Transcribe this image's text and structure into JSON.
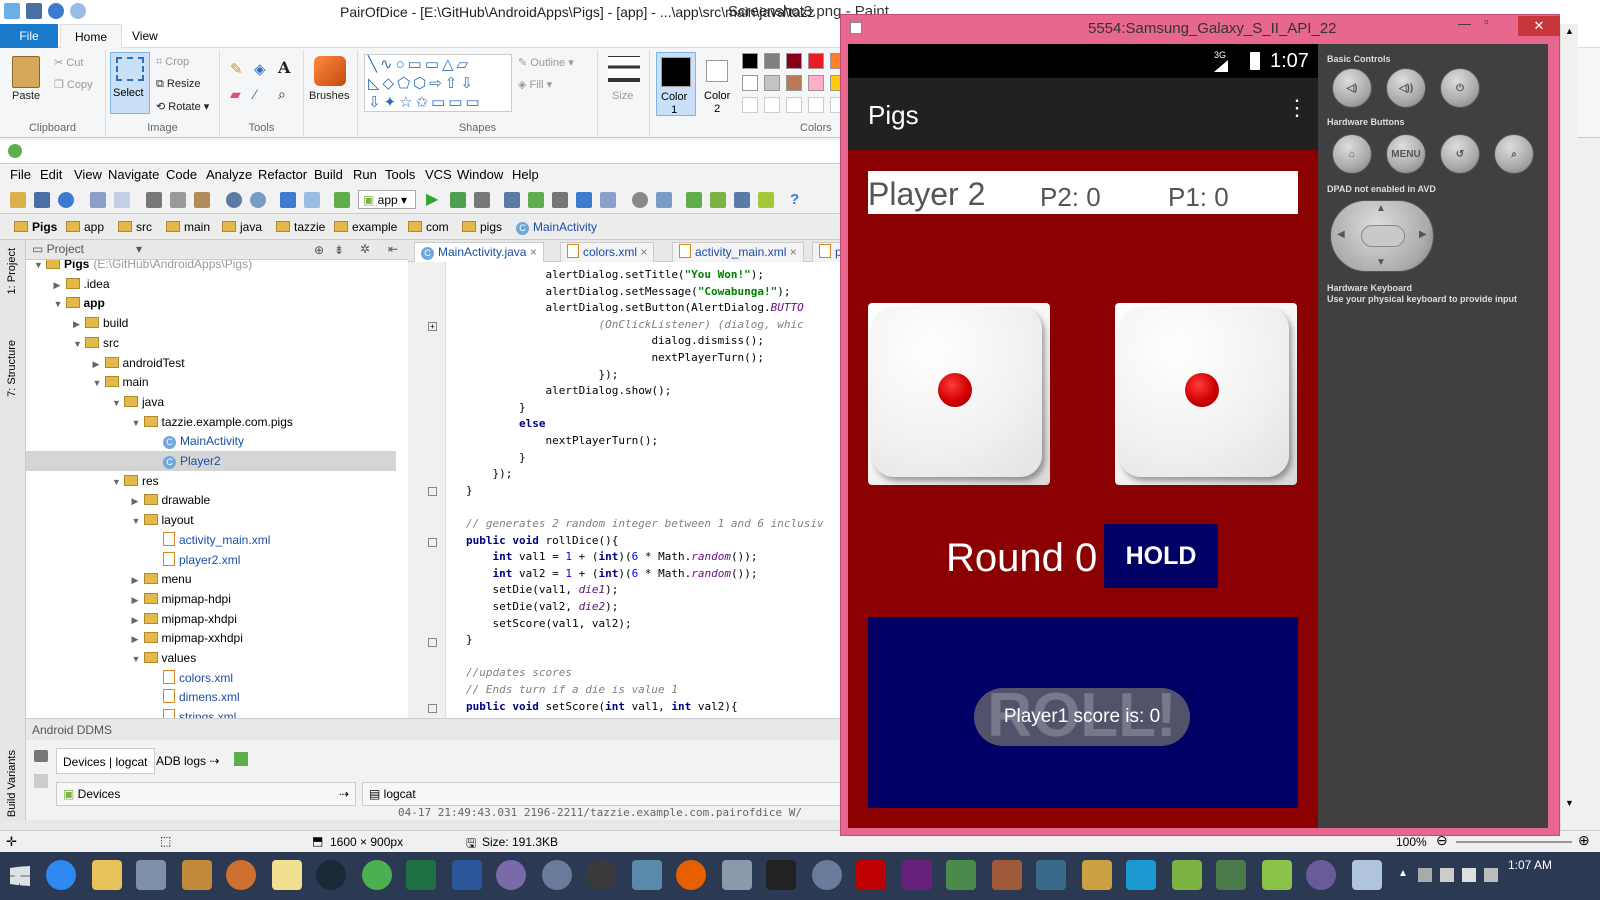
{
  "paint": {
    "title": "Screenshot3.png - Paint",
    "tabs": {
      "file": "File",
      "home": "Home",
      "view": "View"
    },
    "clipboard": {
      "paste": "Paste",
      "cut": "Cut",
      "copy": "Copy",
      "label": "Clipboard"
    },
    "image": {
      "select": "Select",
      "crop": "Crop",
      "resize": "Resize",
      "rotate": "Rotate",
      "label": "Image"
    },
    "tools_label": "Tools",
    "brushes": "Brushes",
    "shapes": {
      "outline": "Outline",
      "fill": "Fill",
      "label": "Shapes"
    },
    "size": "Size",
    "color1": "Color\n1",
    "color2": "Color\n2",
    "colors_label": "Colors",
    "palette": [
      "#000000",
      "#7f7f7f",
      "#880015",
      "#ed1c24",
      "#ff7f27",
      "#ffffff",
      "#c3c3c3",
      "#b97a57",
      "#ffaec9",
      "#ffc90e"
    ],
    "status": {
      "dimensions": "1600 × 900px",
      "size": "Size: 191.3KB",
      "zoom": "100%"
    }
  },
  "ide": {
    "title": "PairOfDice - [E:\\GitHub\\AndroidApps\\Pigs] - [app] - ...\\app\\src\\main\\java\\tazz",
    "menu": [
      "File",
      "Edit",
      "View",
      "Navigate",
      "Code",
      "Analyze",
      "Refactor",
      "Build",
      "Run",
      "Tools",
      "VCS",
      "Window",
      "Help"
    ],
    "run_config": "app",
    "breadcrumb": [
      "Pigs",
      "app",
      "src",
      "main",
      "java",
      "tazzie",
      "example",
      "com",
      "pigs",
      "MainActivity"
    ],
    "side_tabs": {
      "project": "1: Project",
      "structure": "7: Structure",
      "variants": "Build Variants"
    },
    "project_panel": "Project",
    "tree": [
      {
        "label": "Pigs",
        "extra": "(E:\\GitHub\\AndroidApps\\Pigs)",
        "depth": 0,
        "arrow": "▼",
        "kind": "folder"
      },
      {
        "label": ".idea",
        "depth": 1,
        "arrow": "▶",
        "kind": "folder"
      },
      {
        "label": "app",
        "depth": 1,
        "arrow": "▼",
        "kind": "folder"
      },
      {
        "label": "build",
        "depth": 2,
        "arrow": "▶",
        "kind": "folder"
      },
      {
        "label": "src",
        "depth": 2,
        "arrow": "▼",
        "kind": "folder"
      },
      {
        "label": "androidTest",
        "depth": 3,
        "arrow": "▶",
        "kind": "folder"
      },
      {
        "label": "main",
        "depth": 3,
        "arrow": "▼",
        "kind": "folder"
      },
      {
        "label": "java",
        "depth": 4,
        "arrow": "▼",
        "kind": "folder"
      },
      {
        "label": "tazzie.example.com.pigs",
        "depth": 5,
        "arrow": "▼",
        "kind": "folder"
      },
      {
        "label": "MainActivity",
        "depth": 6,
        "arrow": "",
        "kind": "class"
      },
      {
        "label": "Player2",
        "depth": 6,
        "arrow": "",
        "kind": "class",
        "selected": true
      },
      {
        "label": "res",
        "depth": 4,
        "arrow": "▼",
        "kind": "folder"
      },
      {
        "label": "drawable",
        "depth": 5,
        "arrow": "▶",
        "kind": "folder"
      },
      {
        "label": "layout",
        "depth": 5,
        "arrow": "▼",
        "kind": "folder"
      },
      {
        "label": "activity_main.xml",
        "depth": 6,
        "arrow": "",
        "kind": "xml"
      },
      {
        "label": "player2.xml",
        "depth": 6,
        "arrow": "",
        "kind": "xml"
      },
      {
        "label": "menu",
        "depth": 5,
        "arrow": "▶",
        "kind": "folder"
      },
      {
        "label": "mipmap-hdpi",
        "depth": 5,
        "arrow": "▶",
        "kind": "folder"
      },
      {
        "label": "mipmap-xhdpi",
        "depth": 5,
        "arrow": "▶",
        "kind": "folder"
      },
      {
        "label": "mipmap-xxhdpi",
        "depth": 5,
        "arrow": "▶",
        "kind": "folder"
      },
      {
        "label": "values",
        "depth": 5,
        "arrow": "▼",
        "kind": "folder"
      },
      {
        "label": "colors.xml",
        "depth": 6,
        "arrow": "",
        "kind": "xml"
      },
      {
        "label": "dimens.xml",
        "depth": 6,
        "arrow": "",
        "kind": "xml"
      },
      {
        "label": "strings.xml",
        "depth": 6,
        "arrow": "",
        "kind": "xml"
      }
    ],
    "editor_tabs": [
      "MainActivity.java",
      "colors.xml",
      "activity_main.xml",
      "play"
    ],
    "code": [
      {
        "i": "            ",
        "t": [
          [
            "",
            "alertDialog.setTitle("
          ],
          [
            "str",
            "\"You Won!\""
          ],
          [
            "",
            ");"
          ]
        ]
      },
      {
        "i": "            ",
        "t": [
          [
            "",
            "alertDialog.setMessage("
          ],
          [
            "str",
            "\"Cowabunga!\""
          ],
          [
            "",
            ");"
          ]
        ]
      },
      {
        "i": "            ",
        "t": [
          [
            "",
            "alertDialog.setButton(AlertDialog."
          ],
          [
            "fld",
            "BUTTO"
          ]
        ]
      },
      {
        "i": "                    ",
        "t": [
          [
            "cm",
            "(OnClickListener) (dialog, whic"
          ]
        ]
      },
      {
        "i": "                            ",
        "t": [
          [
            "",
            "dialog.dismiss();"
          ]
        ]
      },
      {
        "i": "                            ",
        "t": [
          [
            "",
            "nextPlayerTurn();"
          ]
        ]
      },
      {
        "i": "                    ",
        "t": [
          [
            "",
            "});"
          ]
        ]
      },
      {
        "i": "            ",
        "t": [
          [
            "",
            "alertDialog.show();"
          ]
        ]
      },
      {
        "i": "        ",
        "t": [
          [
            "",
            "}"
          ]
        ]
      },
      {
        "i": "        ",
        "t": [
          [
            "kw",
            "else"
          ]
        ]
      },
      {
        "i": "            ",
        "t": [
          [
            "",
            "nextPlayerTurn();"
          ]
        ]
      },
      {
        "i": "        ",
        "t": [
          [
            "",
            "}"
          ]
        ]
      },
      {
        "i": "    ",
        "t": [
          [
            "",
            "});"
          ]
        ]
      },
      {
        "i": "",
        "t": [
          [
            "",
            "}"
          ]
        ]
      },
      {
        "i": "",
        "t": [
          [
            "",
            ""
          ]
        ]
      },
      {
        "i": "",
        "t": [
          [
            "cm",
            "// generates 2 random integer between 1 and 6 inclusiv"
          ]
        ]
      },
      {
        "i": "",
        "t": [
          [
            "kw",
            "public void "
          ],
          [
            "",
            "rollDice(){"
          ]
        ]
      },
      {
        "i": "    ",
        "t": [
          [
            "kw",
            "int "
          ],
          [
            "",
            "val1 = "
          ],
          [
            "num",
            "1"
          ],
          [
            "",
            " + ("
          ],
          [
            "kw",
            "int"
          ],
          [
            "",
            ")("
          ],
          [
            "num",
            "6"
          ],
          [
            "",
            " * Math."
          ],
          [
            "fld",
            "random"
          ],
          [
            "",
            "());"
          ]
        ]
      },
      {
        "i": "    ",
        "t": [
          [
            "kw",
            "int "
          ],
          [
            "",
            "val2 = "
          ],
          [
            "num",
            "1"
          ],
          [
            "",
            " + ("
          ],
          [
            "kw",
            "int"
          ],
          [
            "",
            ")("
          ],
          [
            "num",
            "6"
          ],
          [
            "",
            " * Math."
          ],
          [
            "fld",
            "random"
          ],
          [
            "",
            "());"
          ]
        ]
      },
      {
        "i": "    ",
        "t": [
          [
            "",
            "setDie(val1, "
          ],
          [
            "fld",
            "die1"
          ],
          [
            "",
            ");"
          ]
        ]
      },
      {
        "i": "    ",
        "t": [
          [
            "",
            "setDie(val2, "
          ],
          [
            "fld",
            "die2"
          ],
          [
            "",
            ");"
          ]
        ]
      },
      {
        "i": "    ",
        "t": [
          [
            "",
            "setScore(val1, val2);"
          ]
        ]
      },
      {
        "i": "",
        "t": [
          [
            "",
            "}"
          ]
        ]
      },
      {
        "i": "",
        "t": [
          [
            "",
            ""
          ]
        ]
      },
      {
        "i": "",
        "t": [
          [
            "cm",
            "//updates scores"
          ]
        ]
      },
      {
        "i": "",
        "t": [
          [
            "cm",
            "// Ends turn if a die is value 1"
          ]
        ]
      },
      {
        "i": "",
        "t": [
          [
            "kw",
            "public void "
          ],
          [
            "",
            "setScore("
          ],
          [
            "kw",
            "int "
          ],
          [
            "",
            "val1, "
          ],
          [
            "kw",
            "int "
          ],
          [
            "",
            "val2){"
          ]
        ]
      }
    ],
    "ddms": {
      "title": "Android DDMS",
      "devices_tab": "Devices | logcat",
      "adb_tab": "ADB logs",
      "devices": "Devices",
      "logcat": "logcat",
      "log_line": "04-17 21:49:43.031    2196-2211/tazzie.example.com.pairofdice W/"
    }
  },
  "emulator": {
    "title": "5554:Samsung_Galaxy_S_II_API_22",
    "network": "3G",
    "time": "1:07",
    "app": {
      "title": "Pigs",
      "player": "Player 2",
      "p2": "P2: 0",
      "p1": "P1: 0",
      "round": "Round 0",
      "hold": "HOLD",
      "roll": "ROLL!",
      "toast": "Player1 score is: 0"
    },
    "controls": {
      "basic": "Basic Controls",
      "hardware": "Hardware Buttons",
      "menu": "MENU",
      "dpad": "DPAD not enabled in AVD",
      "keyboard": "Hardware Keyboard",
      "keyboard_sub": "Use your physical keyboard to provide input"
    }
  },
  "taskbar": {
    "time": "1:07 AM"
  }
}
